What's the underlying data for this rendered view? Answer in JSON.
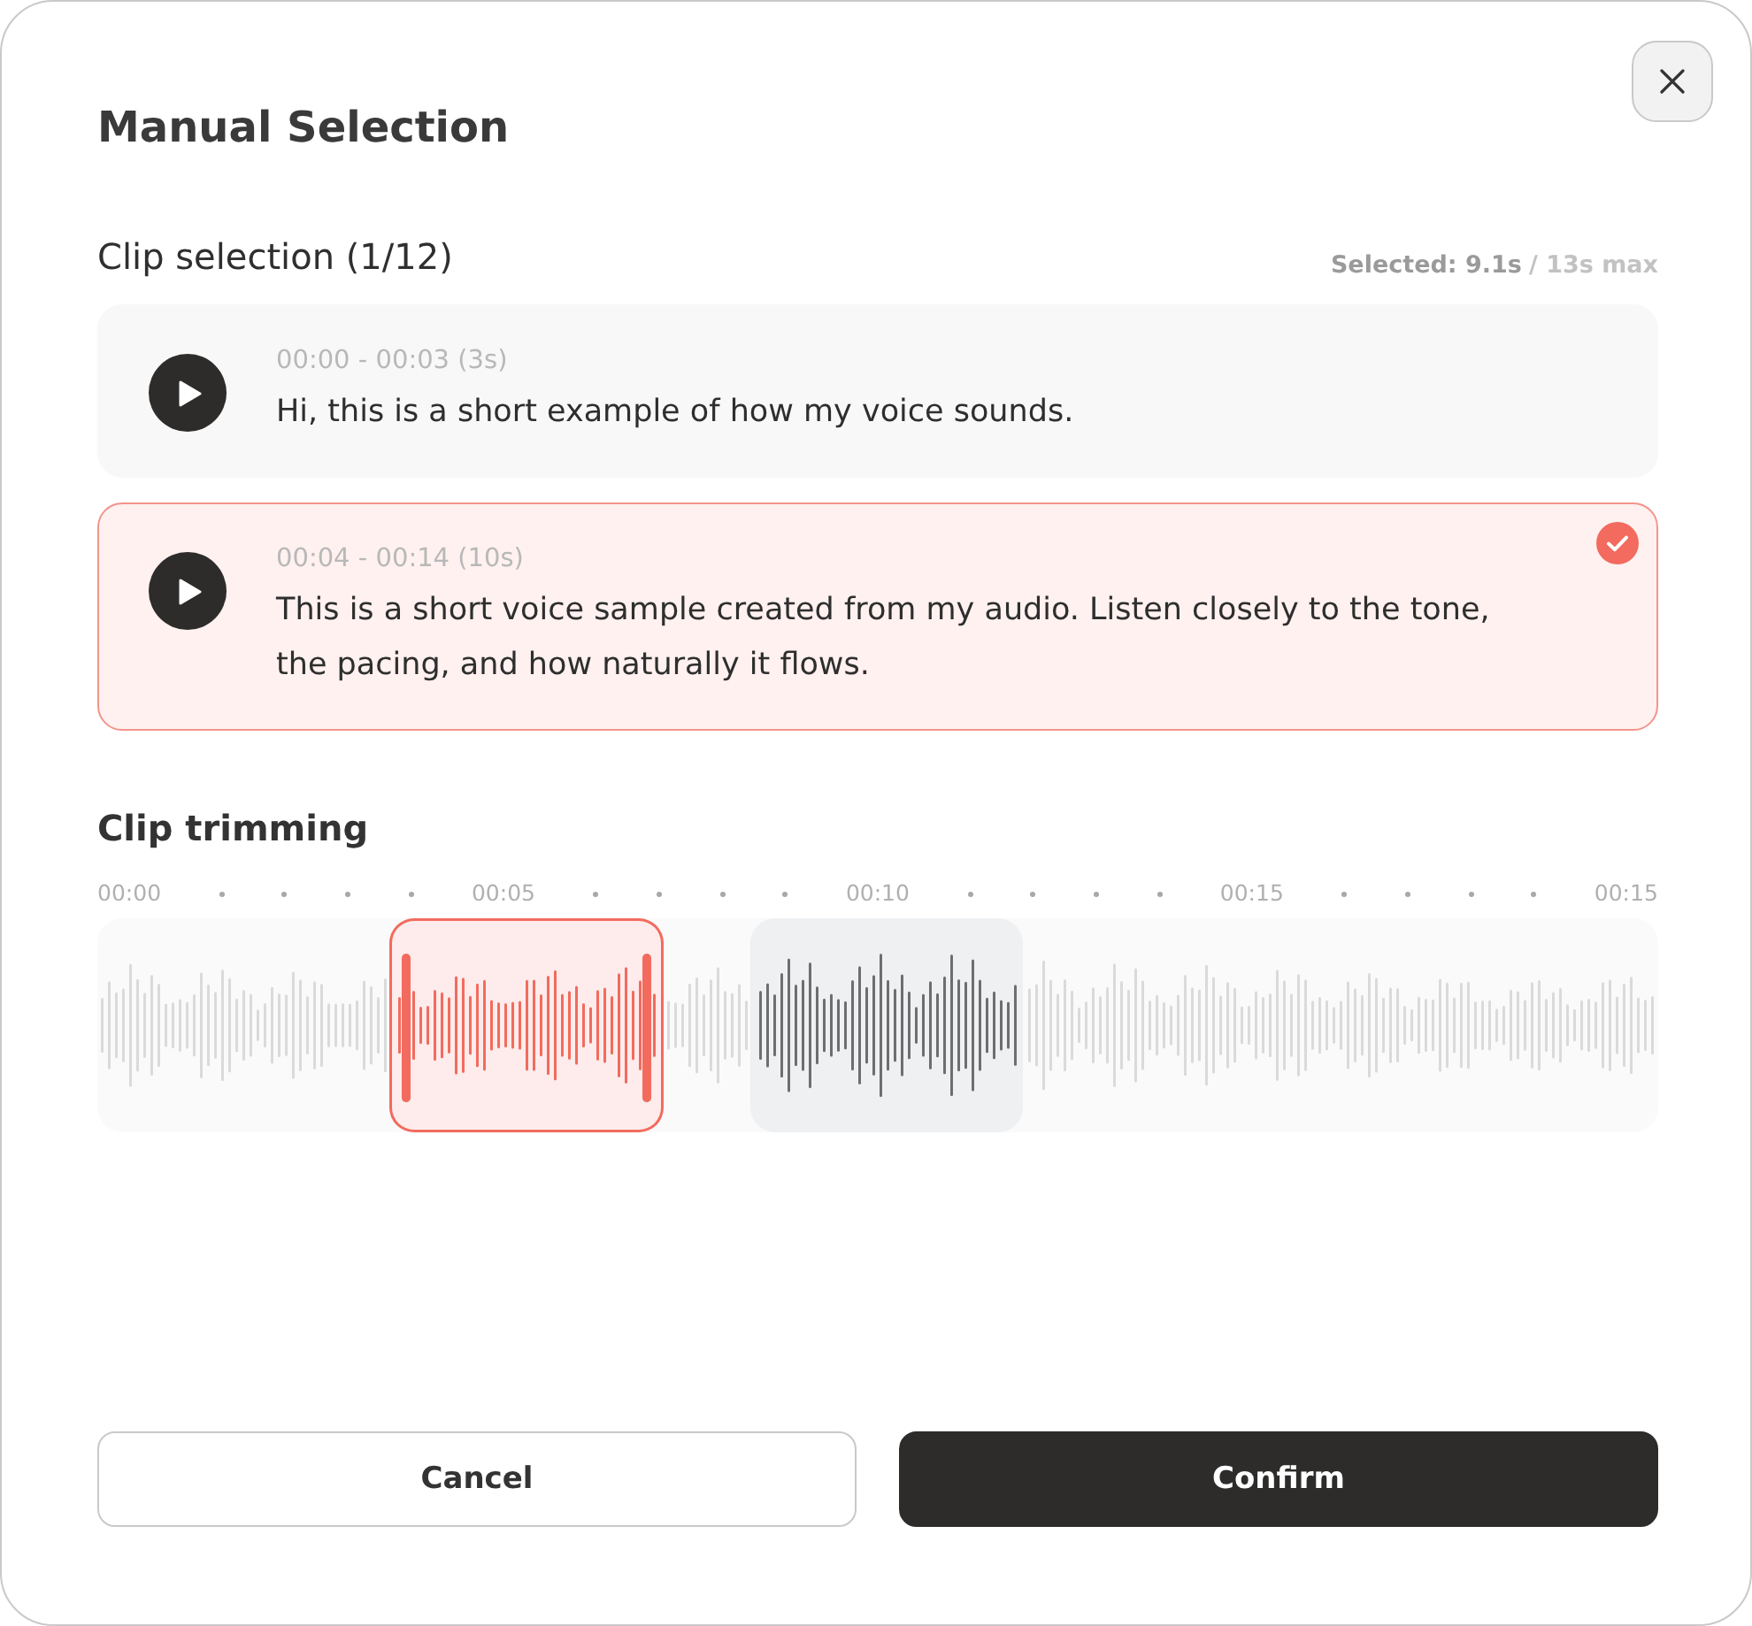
{
  "dialog": {
    "title": "Manual Selection"
  },
  "clip_selection": {
    "heading": "Clip selection (1/12)",
    "selected_total": "Selected: 9.1s",
    "max_total": "/ 13s max",
    "clips": [
      {
        "time": "00:00 - 00:03 (3s)",
        "text": "Hi, this is a short example of how my voice sounds.",
        "selected": false
      },
      {
        "time": "00:04 - 00:14 (10s)",
        "text": "This is a short voice sample created from my audio. Listen closely to the tone, the pacing, and how naturally it flows.",
        "selected": true
      }
    ]
  },
  "clip_trimming": {
    "heading": "Clip trimming",
    "ticks": [
      "00:00",
      "00:05",
      "00:10",
      "00:15",
      "00:15"
    ],
    "regions": [
      {
        "selected": true
      },
      {
        "selected": false
      }
    ]
  },
  "buttons": [
    {
      "label": "Cancel",
      "kind": "secondary"
    },
    {
      "label": "Confirm",
      "kind": "primary"
    }
  ]
}
